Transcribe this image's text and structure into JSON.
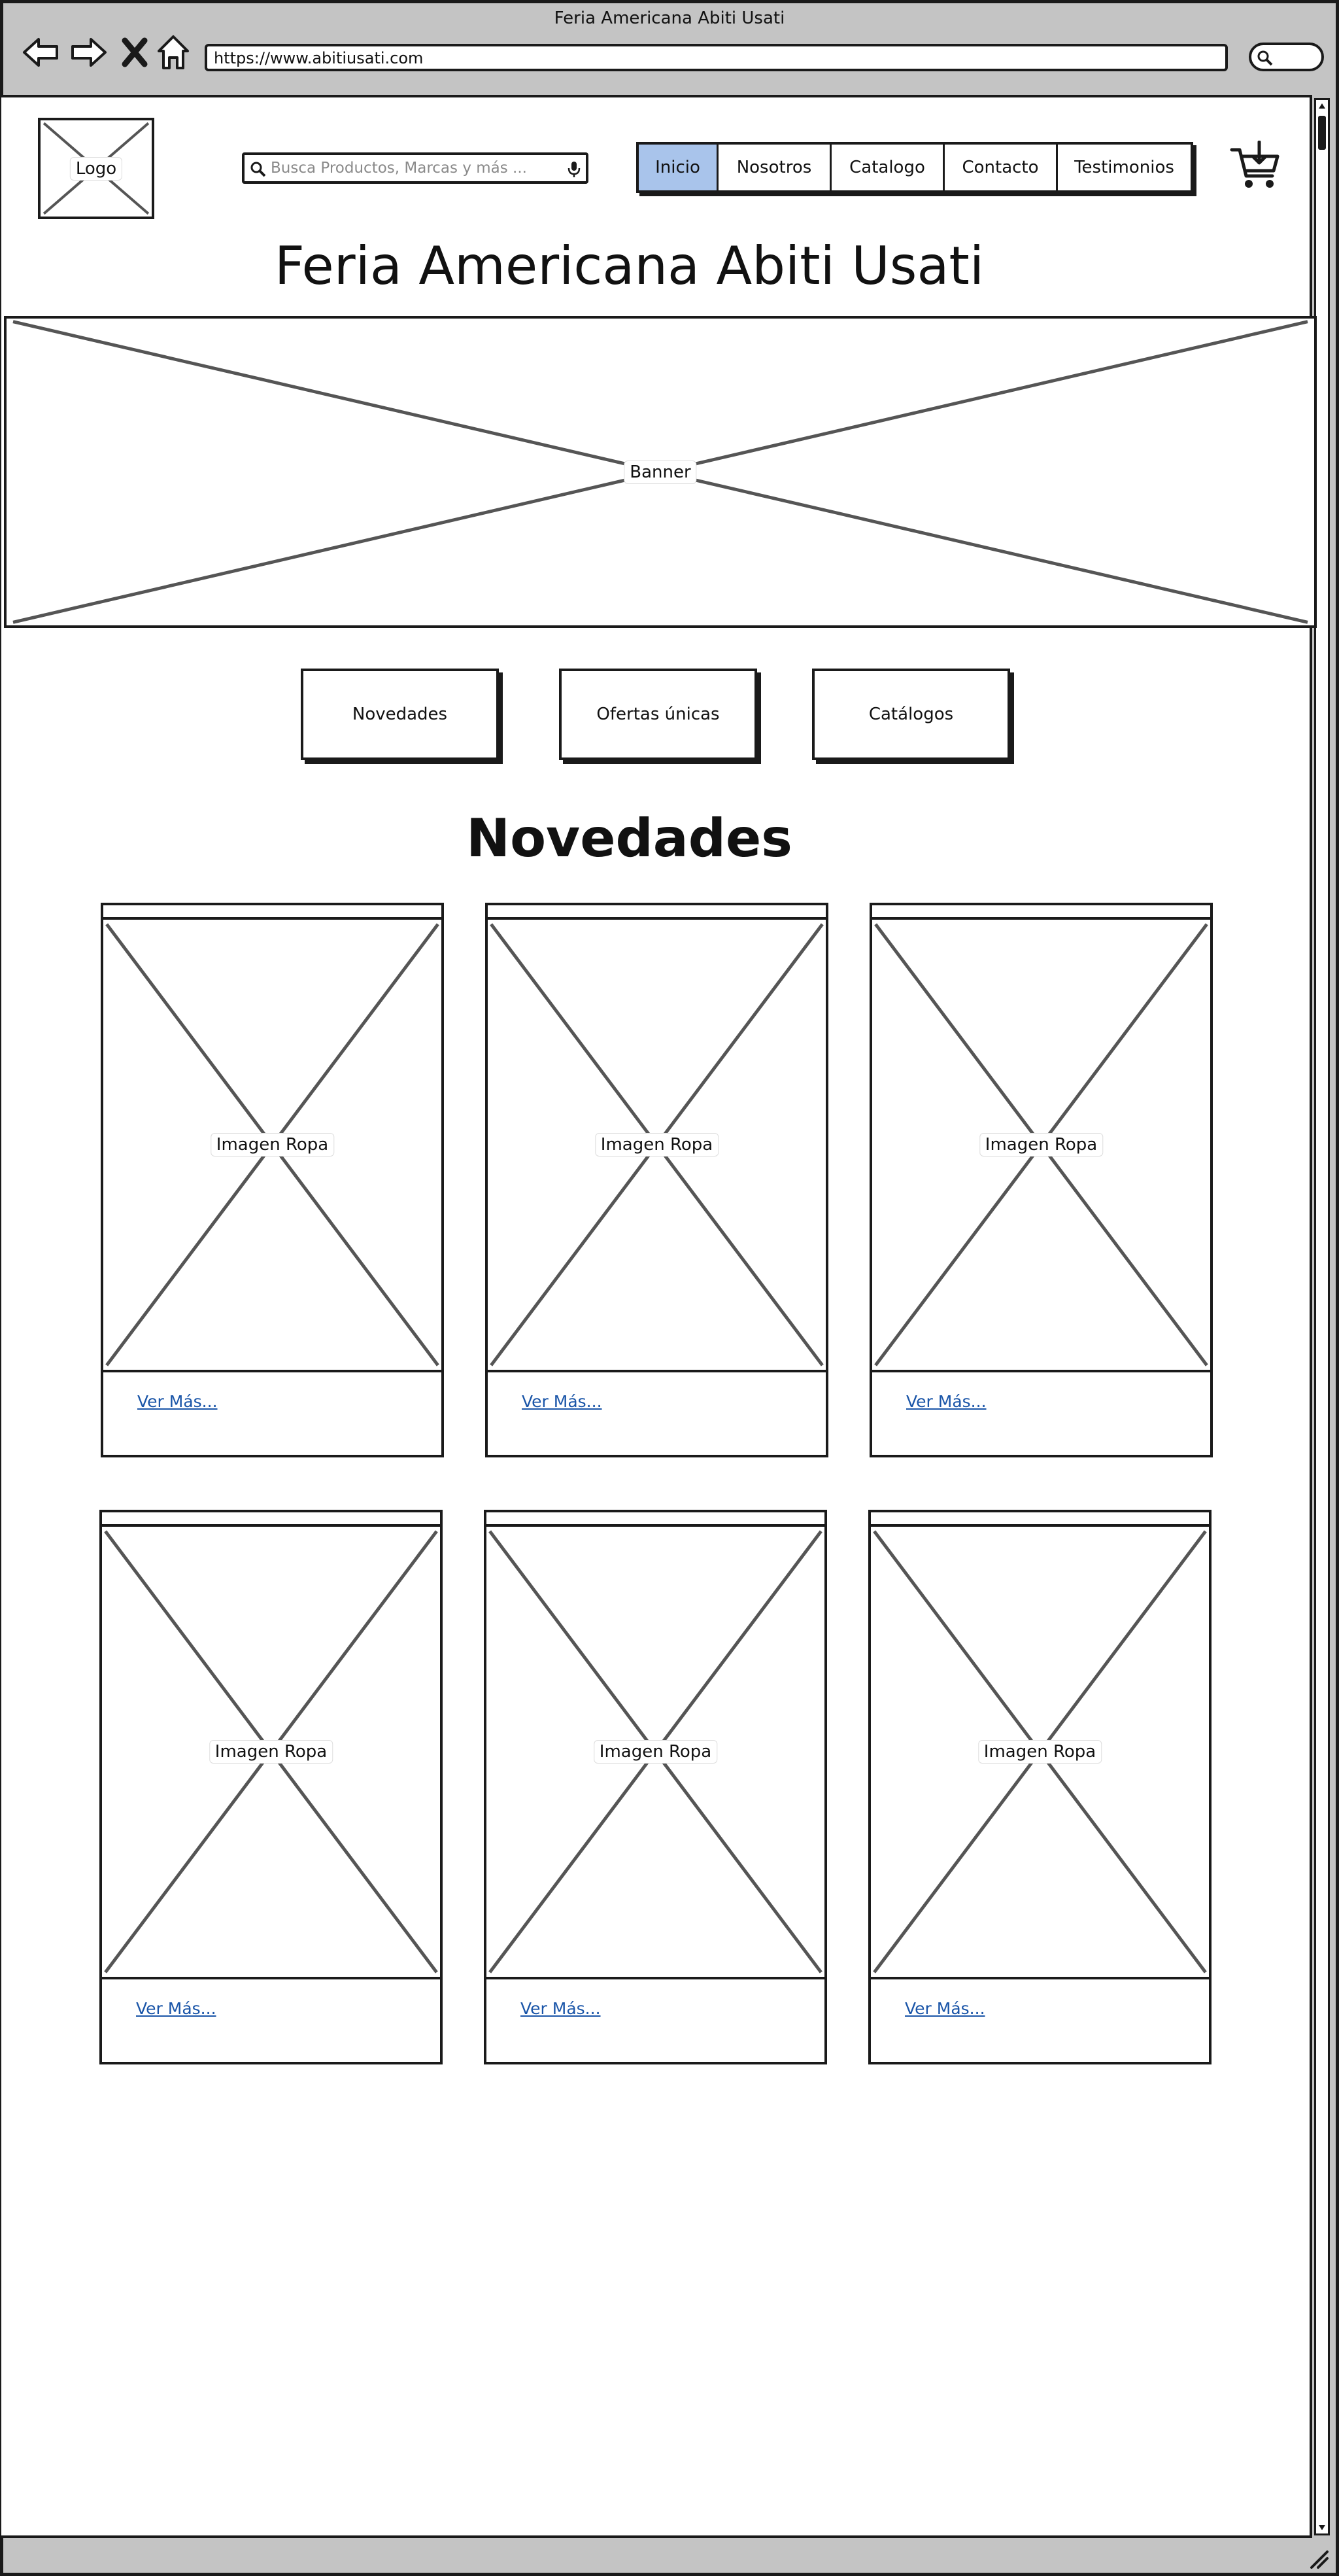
{
  "browser": {
    "window_title": "Feria Americana Abiti Usati",
    "url": "https://www.abitiusati.com"
  },
  "header": {
    "logo_label": "Logo",
    "search_placeholder": "Busca Productos, Marcas y más ...",
    "nav": [
      {
        "label": "Inicio",
        "active": true
      },
      {
        "label": "Nosotros",
        "active": false
      },
      {
        "label": "Catalogo",
        "active": false
      },
      {
        "label": "Contacto",
        "active": false
      },
      {
        "label": "Testimonios",
        "active": false
      }
    ],
    "cart_icon": "cart-icon"
  },
  "site_title": "Feria Americana Abiti Usati",
  "banner_label": "Banner",
  "categories": [
    "Novedades",
    "Ofertas únicas",
    "Catálogos"
  ],
  "section": {
    "title": "Novedades",
    "cards": [
      {
        "image_label": "Imagen Ropa",
        "link": "Ver Más..."
      },
      {
        "image_label": "Imagen Ropa",
        "link": "Ver Más..."
      },
      {
        "image_label": "Imagen Ropa",
        "link": "Ver Más..."
      },
      {
        "image_label": "Imagen Ropa",
        "link": "Ver Más..."
      },
      {
        "image_label": "Imagen Ropa",
        "link": "Ver Más..."
      },
      {
        "image_label": "Imagen Ropa",
        "link": "Ver Más..."
      }
    ]
  },
  "colors": {
    "chrome": "#c4c4c4",
    "active_tab": "#a9c4eb",
    "link": "#1a55a8",
    "stroke": "#1a1a1a"
  }
}
